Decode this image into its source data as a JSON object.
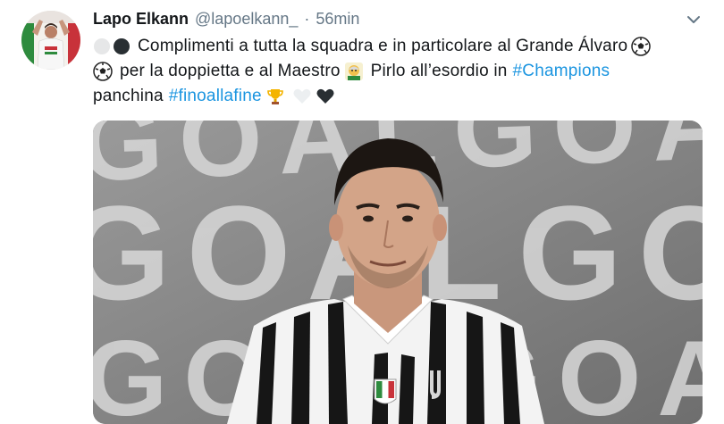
{
  "tweet": {
    "display_name": "Lapo Elkann",
    "handle": "@lapoelkann_",
    "separator": "·",
    "time": "56min",
    "text": {
      "line1_part1": "Complimenti a tutta la squadra e in particolare al Grande Álvaro",
      "line2_part1": "per la doppietta e al Maestro",
      "line2_part2": "Pirlo all’esordio in",
      "hashtag_champions": "#Champions",
      "line3_part1": "panchina",
      "hashtag_finoallafine": "#finoallafine"
    },
    "media": {
      "background_word": "GOAL",
      "kit_colors": [
        "#141414",
        "#f2f2f2"
      ]
    }
  },
  "icons": {
    "avatar": "profile-photo",
    "caret": "chevron-down-icon",
    "emoji": [
      "white-circle-emoji",
      "black-circle-emoji",
      "soccer-ball-emoji",
      "old-man-emoji",
      "trophy-emoji",
      "white-heart-emoji",
      "black-heart-emoji"
    ]
  },
  "colors": {
    "text": "#14171a",
    "secondary": "#657786",
    "link": "#1b95e0"
  }
}
